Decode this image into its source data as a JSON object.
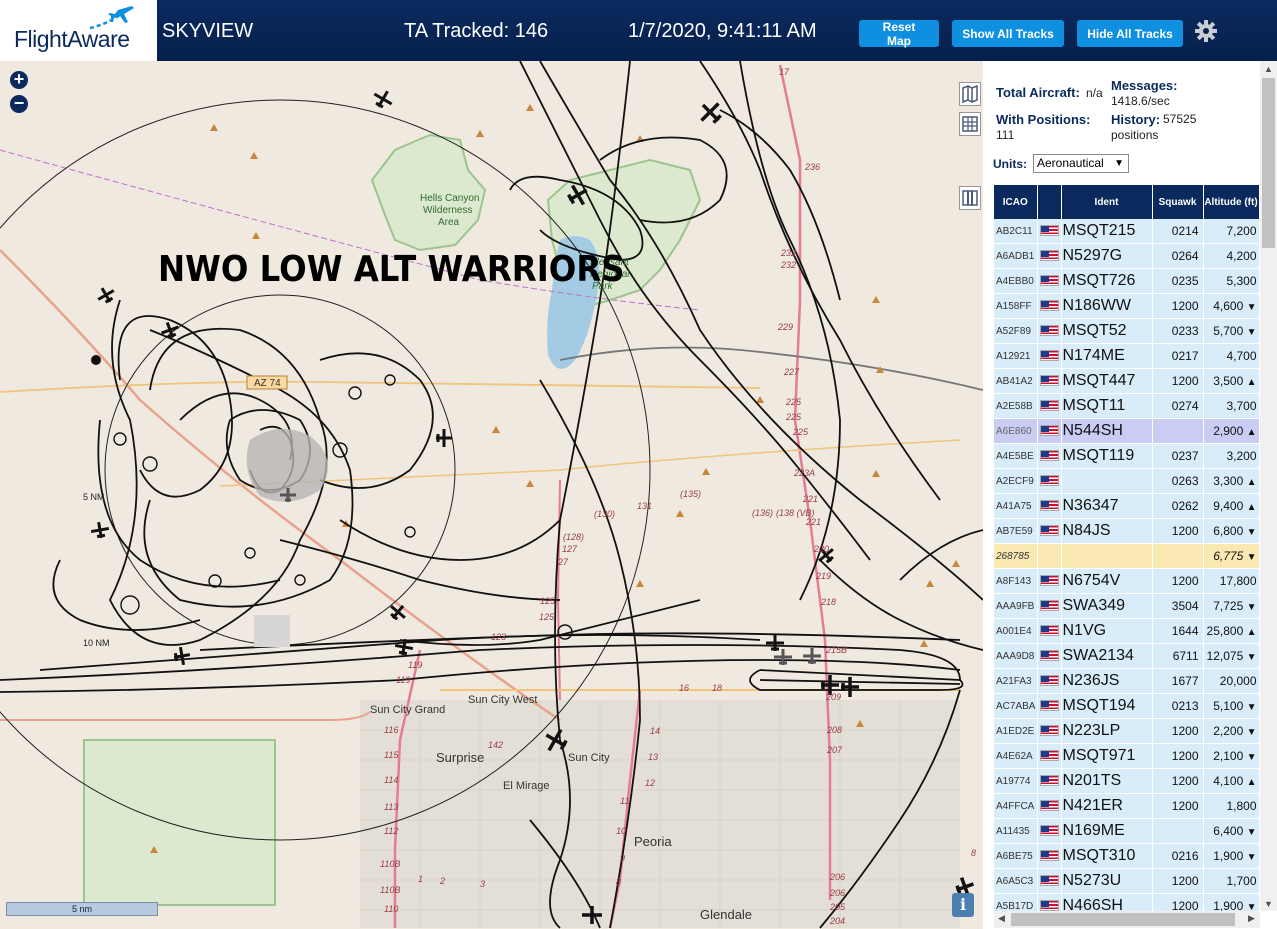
{
  "header": {
    "logo_text": "FlightAware",
    "app_title": "SKYVIEW",
    "tracked_text": "TA Tracked: 146",
    "datetime": "1/7/2020, 9:41:11 AM",
    "reset_map_label": "Reset Map",
    "show_all_tracks_label": "Show All Tracks",
    "hide_all_tracks_label": "Hide All Tracks",
    "settings_icon": "gear-icon"
  },
  "map": {
    "banner_text": "NWO LOW ALT WARRIORS",
    "zoom_in_label": "+",
    "zoom_out_label": "−",
    "scale_label": "5 nm",
    "info_label": "i",
    "labels": {
      "hells_canyon": "Hells Canyon",
      "wilderness": "Wilderness",
      "area": "Area",
      "lake_pleasant_1": "Pleasant",
      "lake_pleasant_2": "Regional",
      "lake_pleasant_3": "Park",
      "az74": "AZ 74",
      "ring_5nm": "5 NM",
      "ring_10nm": "10 NM",
      "sun_city_grand": "Sun City Grand",
      "sun_city_west": "Sun City West",
      "sun_city": "Sun City",
      "surprise": "Surprise",
      "el_mirage": "El Mirage",
      "peoria": "Peoria",
      "glendale": "Glendale",
      "r17": "17",
      "r236": "236",
      "r232a": "232",
      "r232b": "232",
      "r229": "229",
      "r227": "227",
      "r225a": "225",
      "r225b": "225",
      "r223a": "223A",
      "r221a": "221",
      "r221b": "221",
      "r218": "218",
      "r219": "219",
      "r220": "220",
      "r215b": "215B",
      "r135": "(135)",
      "r136": "(136)",
      "r136b": "(138 (VB)",
      "r131": "131",
      "r130": "(130)",
      "r128": "(128)",
      "r127a": "127",
      "r127b": "27",
      "r125a": "125",
      "r125b": "125",
      "r123": "123",
      "r119a": "119",
      "r119b": "119",
      "r116": "116",
      "r115": "115",
      "r114": "114",
      "r113": "113",
      "r112": "112",
      "r110b": "110B",
      "r110b2": "110B",
      "r110": "110",
      "r142": "142",
      "r14": "14",
      "r13": "13",
      "r12": "12",
      "r11": "11",
      "r10": "10",
      "r9": "9",
      "r8": "8",
      "r1": "1",
      "r2": "2",
      "r3": "3",
      "r18": "18",
      "r16": "16",
      "r209": "209",
      "r208": "208",
      "r207": "207",
      "r206a": "206",
      "r206b": "206",
      "r205": "205",
      "r204": "204",
      "r8b": "8"
    }
  },
  "stats": {
    "total_aircraft_label": "Total Aircraft:",
    "total_aircraft_value": "n/a",
    "with_positions_label": "With Positions:",
    "with_positions_value": "111",
    "messages_label": "Messages:",
    "messages_value": "1418.6/sec",
    "history_label": "History:",
    "history_value": "57525",
    "history_unit": "positions",
    "units_label": "Units:",
    "units_value": "Aeronautical"
  },
  "table": {
    "headers": [
      "ICAO",
      "",
      "Ident",
      "Squawk",
      "Altitude (ft)"
    ],
    "rows": [
      {
        "icao": "AB2C11",
        "ident": "MSQT215",
        "squawk": "0214",
        "alt": "7,200",
        "trend": ""
      },
      {
        "icao": "A6ADB1",
        "ident": "N5297G",
        "squawk": "0264",
        "alt": "4,200",
        "trend": ""
      },
      {
        "icao": "A4EBB0",
        "ident": "MSQT726",
        "squawk": "0235",
        "alt": "5,300",
        "trend": ""
      },
      {
        "icao": "A158FF",
        "ident": "N186WW",
        "squawk": "1200",
        "alt": "4,600",
        "trend": "▼"
      },
      {
        "icao": "A52F89",
        "ident": "MSQT52",
        "squawk": "0233",
        "alt": "5,700",
        "trend": "▼"
      },
      {
        "icao": "A12921",
        "ident": "N174ME",
        "squawk": "0217",
        "alt": "4,700",
        "trend": ""
      },
      {
        "icao": "AB41A2",
        "ident": "MSQT447",
        "squawk": "1200",
        "alt": "3,500",
        "trend": "▲"
      },
      {
        "icao": "A2E58B",
        "ident": "MSQT11",
        "squawk": "0274",
        "alt": "3,700",
        "trend": ""
      },
      {
        "icao": "A6E860",
        "ident": "N544SH",
        "squawk": "",
        "alt": "2,900",
        "trend": "▲",
        "selected": true
      },
      {
        "icao": "A4E5BE",
        "ident": "MSQT119",
        "squawk": "0237",
        "alt": "3,200",
        "trend": ""
      },
      {
        "icao": "A2ECF9",
        "ident": "",
        "squawk": "0263",
        "alt": "3,300",
        "trend": "▲"
      },
      {
        "icao": "A41A75",
        "ident": "N36347",
        "squawk": "0262",
        "alt": "9,400",
        "trend": "▲"
      },
      {
        "icao": "AB7E59",
        "ident": "N84JS",
        "squawk": "1200",
        "alt": "6,800",
        "trend": "▼"
      },
      {
        "icao": "268785",
        "ident": "",
        "squawk": "",
        "alt": "6,775",
        "trend": "▼",
        "noid": true
      },
      {
        "icao": "A8F143",
        "ident": "N6754V",
        "squawk": "1200",
        "alt": "17,800",
        "trend": ""
      },
      {
        "icao": "AAA9FB",
        "ident": "SWA349",
        "squawk": "3504",
        "alt": "7,725",
        "trend": "▼"
      },
      {
        "icao": "A001E4",
        "ident": "N1VG",
        "squawk": "1644",
        "alt": "25,800",
        "trend": "▲"
      },
      {
        "icao": "AAA9D8",
        "ident": "SWA2134",
        "squawk": "6711",
        "alt": "12,075",
        "trend": "▼"
      },
      {
        "icao": "A21FA3",
        "ident": "N236JS",
        "squawk": "1677",
        "alt": "20,000",
        "trend": ""
      },
      {
        "icao": "AC7ABA",
        "ident": "MSQT194",
        "squawk": "0213",
        "alt": "5,100",
        "trend": "▼"
      },
      {
        "icao": "A1ED2E",
        "ident": "N223LP",
        "squawk": "1200",
        "alt": "2,200",
        "trend": "▼"
      },
      {
        "icao": "A4E62A",
        "ident": "MSQT971",
        "squawk": "1200",
        "alt": "2,100",
        "trend": "▼"
      },
      {
        "icao": "A19774",
        "ident": "N201TS",
        "squawk": "1200",
        "alt": "4,100",
        "trend": "▲"
      },
      {
        "icao": "A4FFCA",
        "ident": "N421ER",
        "squawk": "1200",
        "alt": "1,800",
        "trend": ""
      },
      {
        "icao": "A11435",
        "ident": "N169ME",
        "squawk": "",
        "alt": "6,400",
        "trend": "▼"
      },
      {
        "icao": "A6BE75",
        "ident": "MSQT310",
        "squawk": "0216",
        "alt": "1,900",
        "trend": "▼"
      },
      {
        "icao": "A6A5C3",
        "ident": "N5273U",
        "squawk": "1200",
        "alt": "1,700",
        "trend": ""
      },
      {
        "icao": "A5B17D",
        "ident": "N466SH",
        "squawk": "1200",
        "alt": "1,900",
        "trend": "▼"
      }
    ]
  },
  "colors": {
    "header_bg": "#06204c",
    "button_blue": "#0f8fe0",
    "table_header": "#0a2a5e",
    "row_bg": "#d9ecfa",
    "row_selected": "#c9cdf4",
    "row_noid": "#fbe9b3"
  }
}
